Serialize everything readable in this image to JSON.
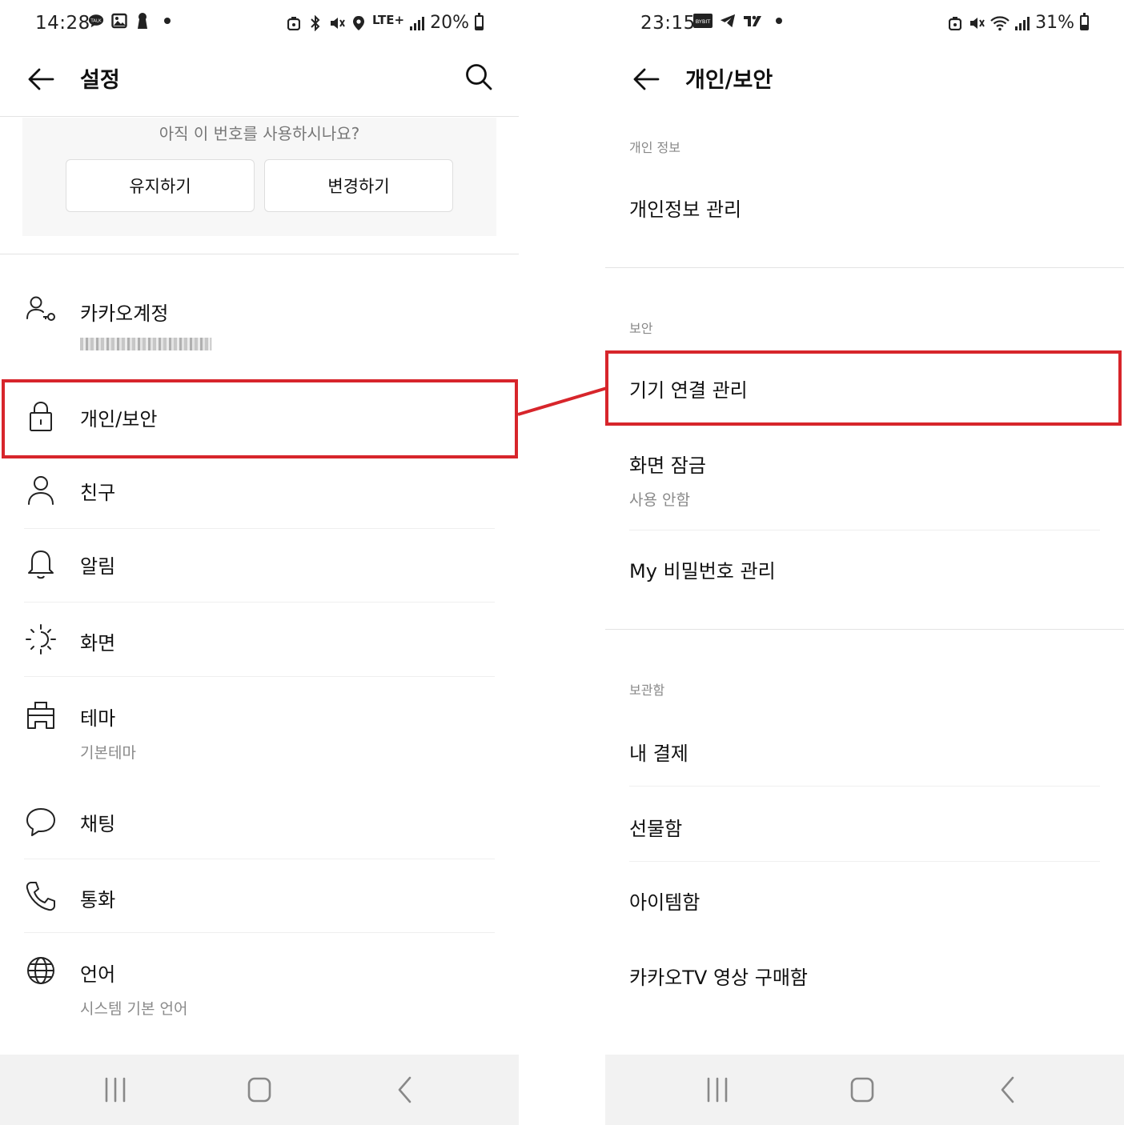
{
  "left": {
    "status": {
      "time": "14:28",
      "network": "LTE+",
      "battery": "20%",
      "battery_level": 0.2
    },
    "appbar": {
      "title": "설정"
    },
    "banner": {
      "question": "아직 이 번호를 사용하시나요?",
      "keep_label": "유지하기",
      "change_label": "변경하기"
    },
    "items": [
      {
        "label": "카카오계정",
        "sub": "",
        "icon": "account-icon"
      },
      {
        "label": "개인/보안",
        "sub": "",
        "icon": "lock-icon"
      },
      {
        "label": "친구",
        "sub": "",
        "icon": "person-icon"
      },
      {
        "label": "알림",
        "sub": "",
        "icon": "bell-icon"
      },
      {
        "label": "화면",
        "sub": "",
        "icon": "brightness-icon"
      },
      {
        "label": "테마",
        "sub": "기본테마",
        "icon": "theme-icon"
      },
      {
        "label": "채팅",
        "sub": "",
        "icon": "chat-bubble-icon"
      },
      {
        "label": "통화",
        "sub": "",
        "icon": "phone-icon"
      },
      {
        "label": "언어",
        "sub": "시스템 기본 언어",
        "icon": "globe-icon"
      }
    ]
  },
  "right": {
    "status": {
      "time": "23:15",
      "battery": "31%",
      "battery_level": 0.31
    },
    "appbar": {
      "title": "개인/보안"
    },
    "sections": [
      {
        "header": "개인 정보",
        "items": [
          {
            "label": "개인정보 관리",
            "sub": ""
          }
        ]
      },
      {
        "header": "보안",
        "items": [
          {
            "label": "기기 연결 관리",
            "sub": ""
          },
          {
            "label": "화면 잠금",
            "sub": "사용 안함"
          },
          {
            "label": "My 비밀번호 관리",
            "sub": ""
          }
        ]
      },
      {
        "header": "보관함",
        "items": [
          {
            "label": "내 결제",
            "sub": ""
          },
          {
            "label": "선물함",
            "sub": ""
          },
          {
            "label": "아이템함",
            "sub": ""
          },
          {
            "label": "카카오TV 영상 구매함",
            "sub": ""
          }
        ]
      }
    ]
  },
  "colors": {
    "highlight": "#d7252b",
    "nav_bar": "#f2f2f2",
    "banner_bg": "#f7f7f7"
  },
  "navbar": {
    "icons": [
      "recent-apps-icon",
      "home-icon",
      "back-nav-icon"
    ]
  }
}
